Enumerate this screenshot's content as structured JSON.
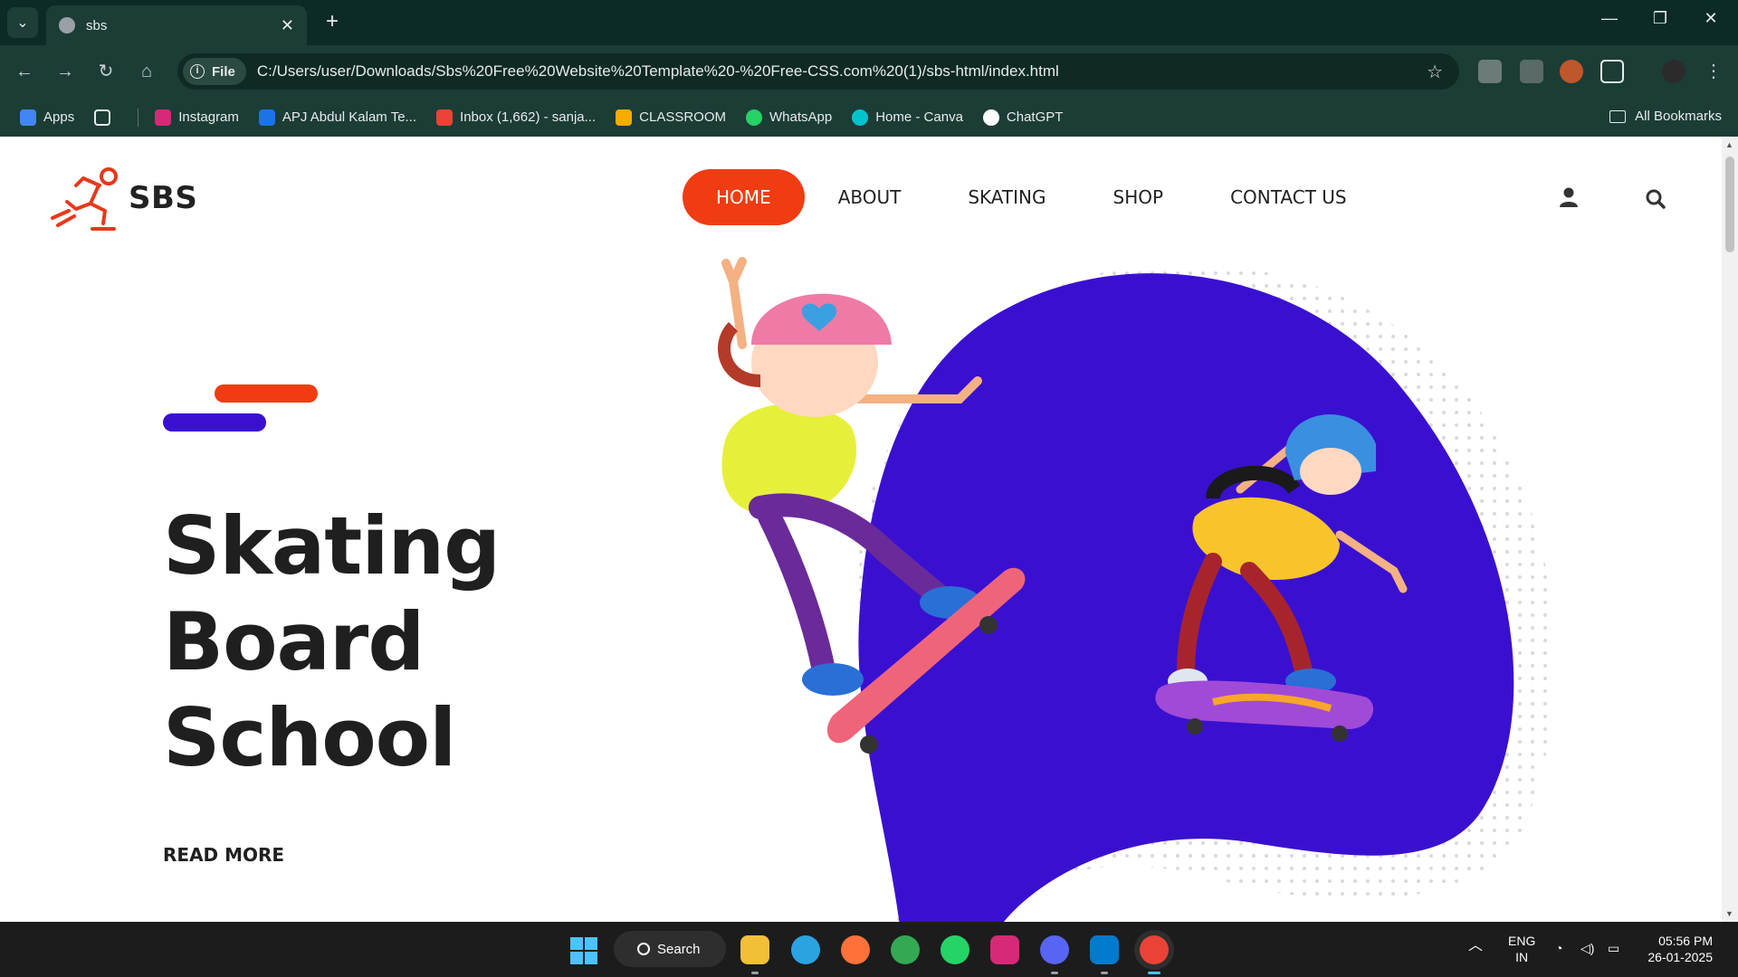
{
  "browser": {
    "tab_title": "sbs",
    "tab_close": "✕",
    "new_tab": "+",
    "url_scheme": "File",
    "url": "C:/Users/user/Downloads/Sbs%20Free%20Website%20Template%20-%20Free-CSS.com%20(1)/sbs-html/index.html",
    "bookmarks": [
      {
        "label": "Apps",
        "color": "#4285f4"
      },
      {
        "label": "Instagram",
        "color": "#d62976"
      },
      {
        "label": "APJ Abdul Kalam Te...",
        "color": "#1a73e8"
      },
      {
        "label": "Inbox (1,662) - sanja...",
        "color": "#ea4335"
      },
      {
        "label": "CLASSROOM",
        "color": "#f9ab00"
      },
      {
        "label": "WhatsApp",
        "color": "#25d366"
      },
      {
        "label": "Home - Canva",
        "color": "#00c4cc"
      },
      {
        "label": "ChatGPT",
        "color": "#ffffff"
      }
    ],
    "all_bookmarks": "All Bookmarks"
  },
  "site": {
    "brand": "SBS",
    "nav": [
      "HOME",
      "ABOUT",
      "SKATING",
      "SHOP",
      "CONTACT US"
    ],
    "active_nav": "HOME",
    "hero_title": [
      "Skating",
      "Board",
      "School"
    ],
    "read_more": "READ MORE",
    "colors": {
      "accent": "#f03c13",
      "secondary": "#3a10d0",
      "text": "#1f1f1f"
    }
  },
  "taskbar": {
    "search_label": "Search",
    "language": "ENG",
    "region": "IN",
    "time": "05:56 PM",
    "date": "26-01-2025"
  }
}
